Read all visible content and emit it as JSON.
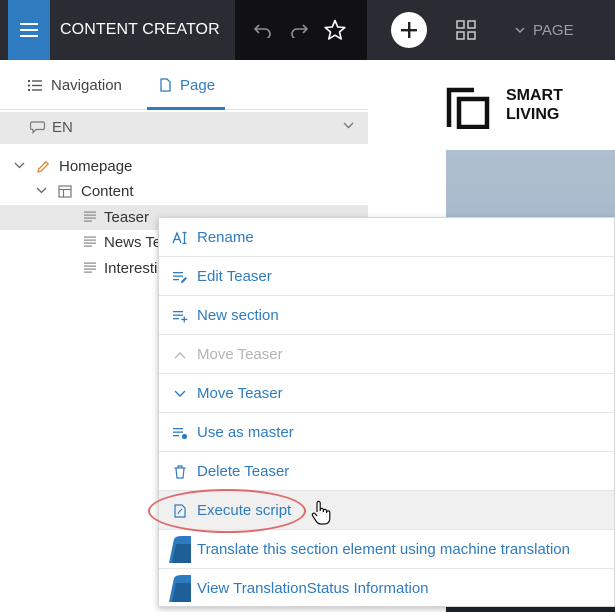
{
  "header": {
    "app_title": "CONTENT CREATOR",
    "page_select_label": "PAGE"
  },
  "panel": {
    "tabs": [
      {
        "label": "Navigation",
        "active": false
      },
      {
        "label": "Page",
        "active": true
      }
    ],
    "language": "EN",
    "tree": [
      {
        "label": "Homepage",
        "level": 0
      },
      {
        "label": "Content",
        "level": 1
      },
      {
        "label": "Teaser",
        "level": 2,
        "selected": true
      },
      {
        "label": "News Te",
        "level": 2
      },
      {
        "label": "Interestin",
        "level": 2
      }
    ]
  },
  "preview": {
    "logo_line1": "SMART",
    "logo_line2": "LIVING"
  },
  "context_menu": {
    "items": [
      {
        "label": "Rename",
        "icon": "rename-icon",
        "enabled": true
      },
      {
        "label": "Edit Teaser",
        "icon": "edit-list-icon",
        "enabled": true
      },
      {
        "label": "New section",
        "icon": "add-list-icon",
        "enabled": true
      },
      {
        "label": "Move Teaser",
        "icon": "chevron-up-icon",
        "enabled": false
      },
      {
        "label": "Move Teaser",
        "icon": "chevron-down-icon",
        "enabled": true
      },
      {
        "label": "Use as master",
        "icon": "master-list-icon",
        "enabled": true
      },
      {
        "label": "Delete Teaser",
        "icon": "trash-icon",
        "enabled": true
      },
      {
        "label": "Execute script",
        "icon": "script-icon",
        "enabled": true,
        "hovered": true
      },
      {
        "label": "Translate this section element using machine translation",
        "icon": "translation-plugin-icon",
        "enabled": true
      },
      {
        "label": "View TranslationStatus Information",
        "icon": "translation-status-icon",
        "enabled": true
      }
    ]
  },
  "colors": {
    "accent": "#2e7bbf",
    "topbar": "#2b2b33",
    "highlight_ring": "#e06a6a"
  }
}
